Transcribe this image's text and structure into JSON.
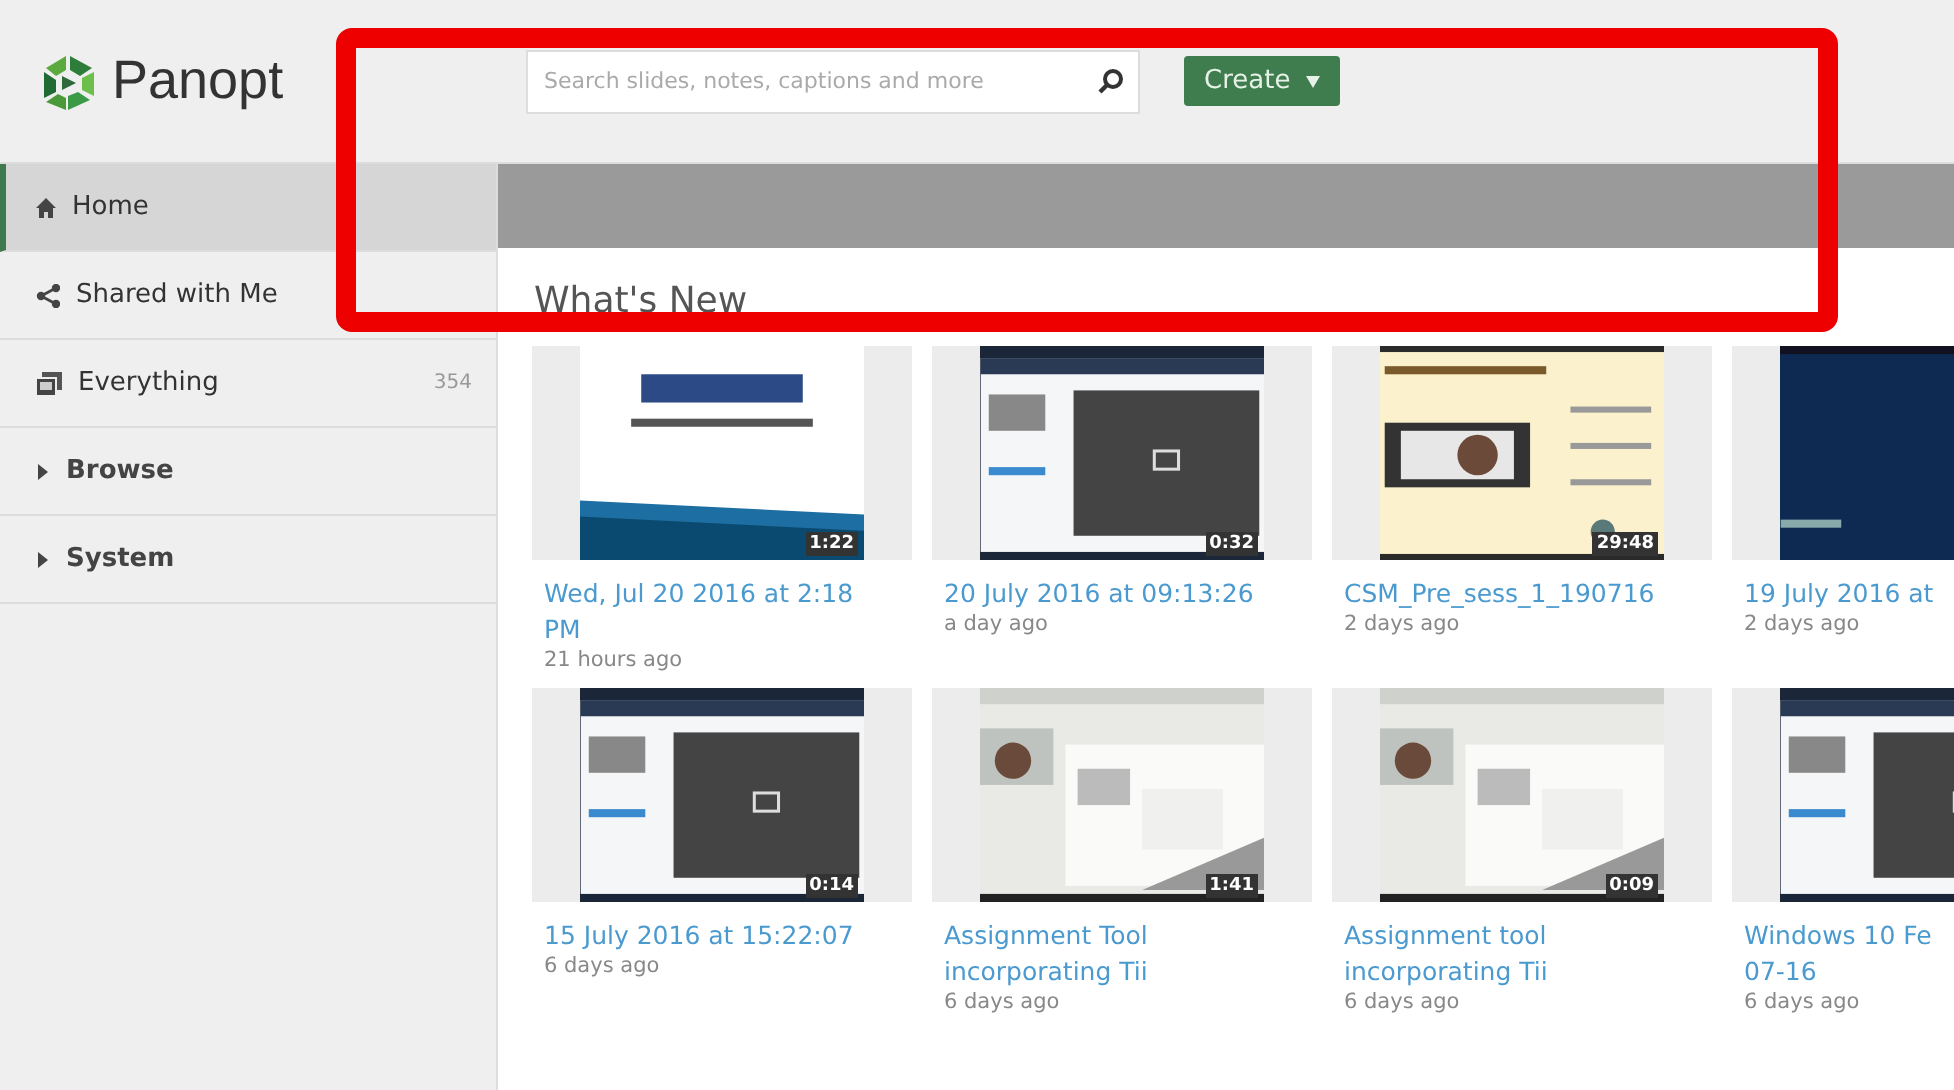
{
  "logo": {
    "text": "Panopt"
  },
  "search": {
    "placeholder": "Search slides, notes, captions and more"
  },
  "create_button": {
    "label": "Create"
  },
  "sidebar": {
    "items": [
      {
        "kind": "link",
        "label": "Home",
        "selected": true
      },
      {
        "kind": "link",
        "label": "Shared with Me",
        "selected": false
      },
      {
        "kind": "link",
        "label": "Everything",
        "count": "354",
        "selected": false
      },
      {
        "kind": "group",
        "label": "Browse",
        "expanded": false
      },
      {
        "kind": "group",
        "label": "System",
        "expanded": false
      }
    ]
  },
  "section_title": "What's New",
  "sessions": [
    {
      "title": "Wed, Jul 20 2016 at 2:18 PM",
      "age": "21 hours ago",
      "duration": "1:22"
    },
    {
      "title": "20 July 2016 at 09:13:26",
      "age": "a day ago",
      "duration": "0:32"
    },
    {
      "title": "CSM_Pre_sess_1_190716",
      "age": "2 days ago",
      "duration": "29:48"
    },
    {
      "title": "19 July 2016 at",
      "age": "2 days ago"
    },
    {
      "title": "15 July 2016 at 15:22:07",
      "age": "6 days ago",
      "duration": "0:14"
    },
    {
      "title": "Assignment Tool incorporating Tii",
      "age": "6 days ago",
      "duration": "1:41"
    },
    {
      "title": "Assignment tool incorporating Tii",
      "age": "6 days ago",
      "duration": "0:09"
    },
    {
      "title": "Windows 10 Fe\n07-16",
      "age": "6 days ago"
    }
  ],
  "highlight": {
    "shown": true
  }
}
